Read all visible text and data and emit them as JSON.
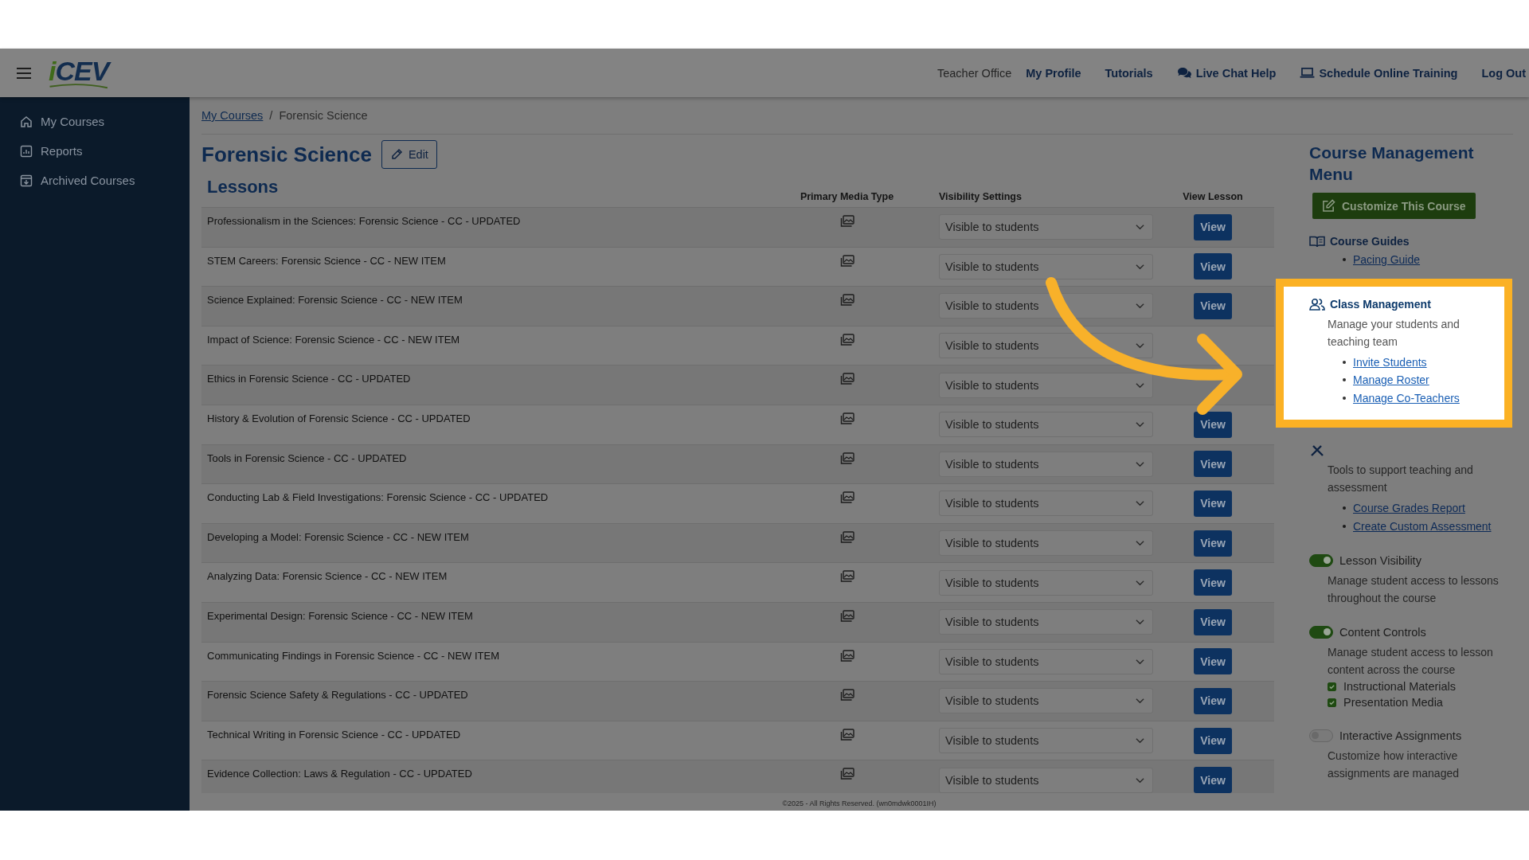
{
  "header": {
    "logo": {
      "prefix": "i",
      "name": "CEV"
    },
    "nav": [
      {
        "label": "Teacher Office",
        "bold": false
      },
      {
        "label": "My Profile",
        "bold": true
      },
      {
        "label": "Tutorials",
        "bold": true
      },
      {
        "label": "Live Chat Help",
        "bold": true
      },
      {
        "label": "Schedule Online Training",
        "bold": true
      },
      {
        "label": "Log Out",
        "bold": true
      }
    ]
  },
  "sidebar": {
    "items": [
      {
        "label": "My Courses"
      },
      {
        "label": "Reports"
      },
      {
        "label": "Archived Courses"
      }
    ]
  },
  "breadcrumb": {
    "separator": "/",
    "items": [
      {
        "label": "My Courses",
        "link": true
      },
      {
        "label": "Forensic Science",
        "link": false
      }
    ]
  },
  "page_title": "Forensic Science",
  "edit_button": "Edit",
  "lessons": {
    "heading": "Lessons",
    "columns": [
      "Primary Media Type",
      "Visibility Settings",
      "View Lesson"
    ],
    "rows": [
      {
        "title": "Professionalism in the Sciences: Forensic Science - CC - UPDATED",
        "visibility": "Visible to students",
        "action": "View"
      },
      {
        "title": "STEM Careers: Forensic Science - CC - NEW ITEM",
        "visibility": "Visible to students",
        "action": "View"
      },
      {
        "title": "Science Explained: Forensic Science - CC - NEW ITEM",
        "visibility": "Visible to students",
        "action": "View"
      },
      {
        "title": "Impact of Science: Forensic Science - CC - NEW ITEM",
        "visibility": "Visible to students"
      },
      {
        "title": "Ethics in Forensic Science - CC - UPDATED",
        "visibility": "Visible to students"
      },
      {
        "title": "History & Evolution of Forensic Science - CC - UPDATED",
        "visibility": "Visible to students",
        "action": "View"
      },
      {
        "title": "Tools in Forensic Science - CC - UPDATED",
        "visibility": "Visible to students",
        "action": "View"
      },
      {
        "title": "Conducting Lab & Field Investigations: Forensic Science - CC - UPDATED",
        "visibility": "Visible to students",
        "action": "View"
      },
      {
        "title": "Developing a Model: Forensic Science - CC - NEW ITEM",
        "visibility": "Visible to students",
        "action": "View"
      },
      {
        "title": "Analyzing Data: Forensic Science - CC - NEW ITEM",
        "visibility": "Visible to students",
        "action": "View"
      },
      {
        "title": "Experimental Design: Forensic Science - CC - NEW ITEM",
        "visibility": "Visible to students",
        "action": "View"
      },
      {
        "title": "Communicating Findings in Forensic Science - CC - NEW ITEM",
        "visibility": "Visible to students",
        "action": "View"
      },
      {
        "title": "Forensic Science Safety & Regulations - CC - UPDATED",
        "visibility": "Visible to students",
        "action": "View"
      },
      {
        "title": "Technical Writing in Forensic Science - CC - UPDATED",
        "visibility": "Visible to students",
        "action": "View"
      },
      {
        "title": "Evidence Collection: Laws & Regulation - CC - UPDATED",
        "visibility": "Visible to students",
        "action": "View"
      }
    ]
  },
  "menu": {
    "title": "Course Management Menu",
    "customize_button": "Customize This Course",
    "sections": [
      {
        "kind": "links",
        "heading": "Course Guides",
        "highlighted": false,
        "links": [
          "Pacing Guide"
        ]
      },
      {
        "kind": "links",
        "heading": "Class Management",
        "highlighted": true,
        "description": "Manage your students and teaching team",
        "links": [
          "Invite Students",
          "Manage Roster",
          "Manage Co-Teachers"
        ]
      },
      {
        "kind": "links",
        "highlighted": false,
        "description": "Tools to support teaching and assessment",
        "links": [
          "Course Grades Report",
          "Create Custom Assessment"
        ]
      },
      {
        "kind": "toggle",
        "label": "Lesson Visibility",
        "on": true,
        "description": "Manage student access to lessons throughout the course"
      },
      {
        "kind": "toggle",
        "label": "Content Controls",
        "on": true,
        "description": "Manage student access to lesson content across the course",
        "checkboxes": [
          {
            "label": "Instructional Materials",
            "checked": true
          },
          {
            "label": "Presentation Media",
            "checked": true
          }
        ]
      },
      {
        "kind": "toggle",
        "label": "Interactive Assignments",
        "on": false,
        "description": "Customize how interactive assignments are managed"
      }
    ]
  },
  "footer": "©2025 - All Rights Reserved. (wn0mdwk0001IH)"
}
